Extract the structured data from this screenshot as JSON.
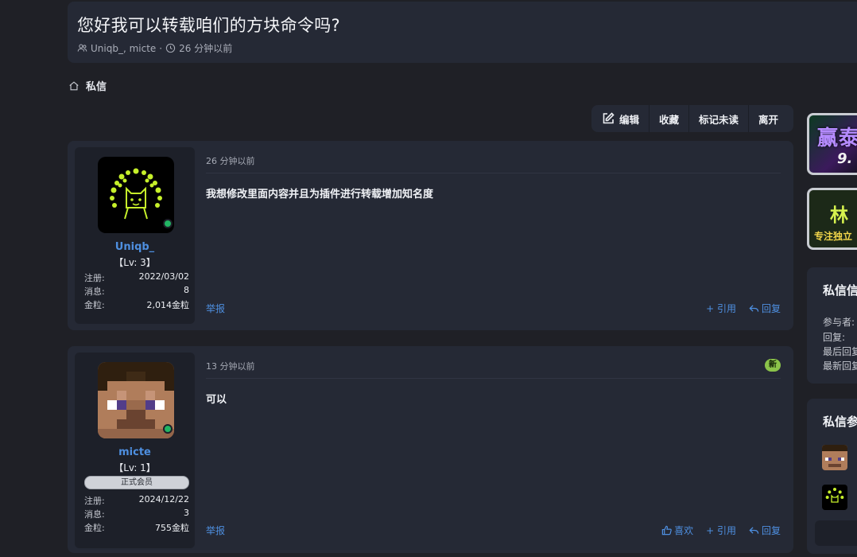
{
  "thread": {
    "title": "您好我可以转载咱们的方块命令吗?",
    "participants": "Uniqb_, micte",
    "separator": "·",
    "time": "26 分钟以前"
  },
  "breadcrumb": {
    "label": "私信"
  },
  "toolbar": {
    "edit": "编辑",
    "bookmark": "收藏",
    "mark_unread": "标记未读",
    "leave": "离开"
  },
  "posts": [
    {
      "username": "Uniqb_",
      "level": "【Lv: 3】",
      "stats": [
        {
          "label": "注册:",
          "value": "2022/03/02"
        },
        {
          "label": "消息:",
          "value": "8"
        },
        {
          "label": "金粒:",
          "value": "2,014金粒"
        }
      ],
      "time": "26 分钟以前",
      "body": "我想修改里面内容并且为插件进行转载增加知名度",
      "report": "举报",
      "quote": "+ 引用",
      "reply": "回复"
    },
    {
      "username": "micte",
      "level": "【Lv: 1】",
      "rank": "正式会员",
      "stats": [
        {
          "label": "注册:",
          "value": "2024/12/22"
        },
        {
          "label": "消息:",
          "value": "3"
        },
        {
          "label": "金粒:",
          "value": "755金粒"
        }
      ],
      "time": "13 分钟以前",
      "new_badge": "新",
      "body": "可以",
      "report": "举报",
      "like": "喜欢",
      "quote": "+ 引用",
      "reply": "回复"
    }
  ],
  "sidebar": {
    "banner1": {
      "text": "赢泰",
      "sub": "9."
    },
    "banner2": {
      "text": "林",
      "sub": "专注独立"
    },
    "info": {
      "title": "私信信",
      "lines": [
        "参与者:",
        "回复:",
        "最后回复",
        "最新回复"
      ]
    },
    "participants": {
      "title": "私信参"
    }
  },
  "colors": {
    "accent": "#4e8fe0",
    "online": "#22b563",
    "new": "#8bc34a"
  }
}
